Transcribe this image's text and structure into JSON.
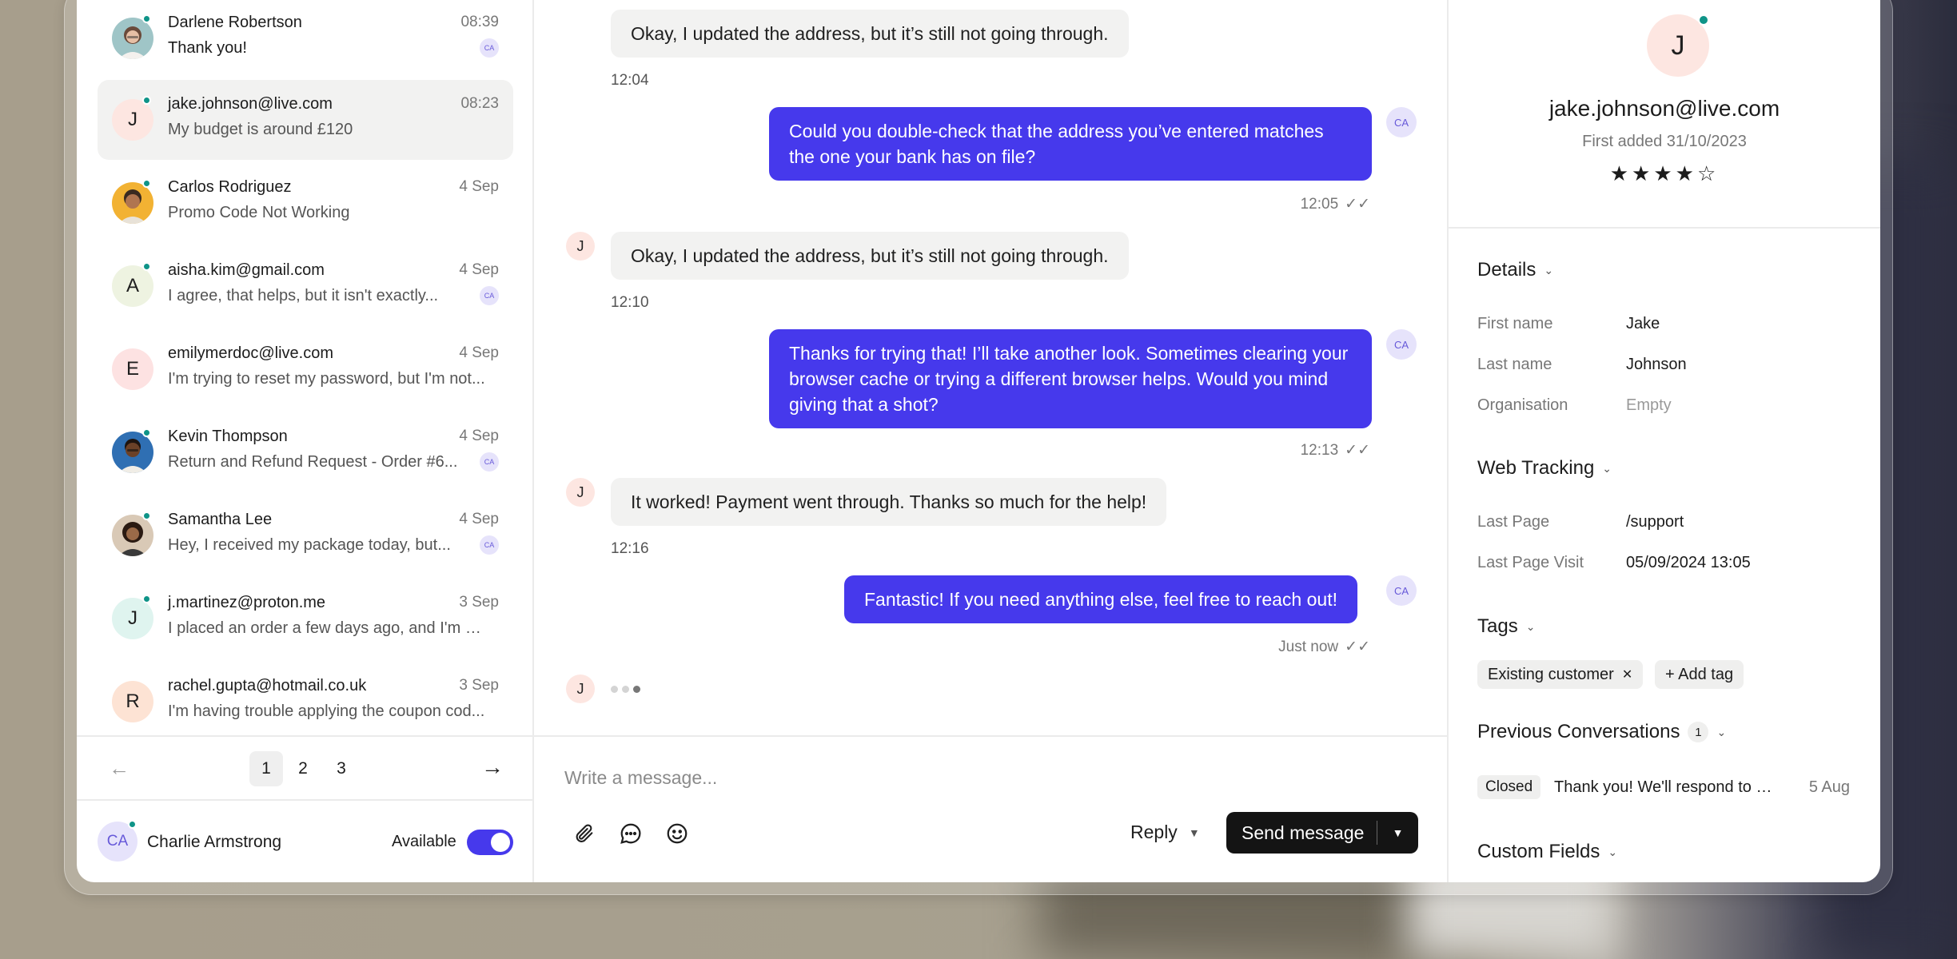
{
  "conversations": [
    {
      "name": "Darlene Robertson",
      "time": "08:39",
      "preview": "Thank you!",
      "initial": "",
      "agent_badge": "CA",
      "active": false
    },
    {
      "name": "jake.johnson@live.com",
      "time": "08:23",
      "preview": "My budget is around £120",
      "initial": "J",
      "agent_badge": "",
      "active": true
    },
    {
      "name": "Carlos Rodriguez",
      "time": "4 Sep",
      "preview": "Promo Code Not Working",
      "initial": "",
      "agent_badge": "",
      "active": false
    },
    {
      "name": "aisha.kim@gmail.com",
      "time": "4 Sep",
      "preview": "I agree, that helps, but it isn't exactly...",
      "initial": "A",
      "agent_badge": "CA",
      "active": false
    },
    {
      "name": "emilymerdoc@live.com",
      "time": "4 Sep",
      "preview": "I'm trying to reset my password, but I'm not...",
      "initial": "E",
      "agent_badge": "",
      "active": false
    },
    {
      "name": "Kevin Thompson",
      "time": "4 Sep",
      "preview": "Return and Refund Request - Order #6...",
      "initial": "",
      "agent_badge": "CA",
      "active": false
    },
    {
      "name": "Samantha Lee",
      "time": "4 Sep",
      "preview": "Hey, I received my package today, but...",
      "initial": "",
      "agent_badge": "CA",
      "active": false
    },
    {
      "name": "j.martinez@proton.me",
      "time": "3 Sep",
      "preview": "I placed an order a few days ago, and I'm w...",
      "initial": "J",
      "agent_badge": "",
      "active": false
    },
    {
      "name": "rachel.gupta@hotmail.co.uk",
      "time": "3 Sep",
      "preview": "I'm having trouble applying the coupon cod...",
      "initial": "R",
      "agent_badge": "",
      "active": false
    }
  ],
  "pagination": {
    "pages": [
      "1",
      "2",
      "3"
    ],
    "current": "1",
    "prev_icon": "arrow-left-icon",
    "next_icon": "arrow-right-icon"
  },
  "agent": {
    "initials": "CA",
    "name": "Charlie Armstrong",
    "status_label": "Available",
    "available": true
  },
  "messages": [
    {
      "dir": "in",
      "text": "Okay, I updated the address, but it’s still not going through.",
      "time": "12:04",
      "avatar": ""
    },
    {
      "dir": "out",
      "text": "Could you double-check that the address you’ve entered matches the one your bank has on file?",
      "time": "12:05",
      "avatar": "CA"
    },
    {
      "dir": "in",
      "text": "Okay, I updated the address, but it’s still not going through.",
      "time": "12:10",
      "avatar": "J"
    },
    {
      "dir": "out",
      "text": "Thanks for trying that! I’ll take another look. Sometimes clearing your browser cache or trying a different browser helps. Would you mind giving that a shot?",
      "time": "12:13",
      "avatar": "CA"
    },
    {
      "dir": "in",
      "text": "It worked! Payment went through. Thanks so much for the help!",
      "time": "12:16",
      "avatar": "J"
    },
    {
      "dir": "out",
      "text": "Fantastic! If you need anything else, feel free to reach out!",
      "time": "Just now",
      "avatar": "CA"
    }
  ],
  "typing_avatar": "J",
  "composer": {
    "placeholder": "Write a message...",
    "reply_label": "Reply",
    "send_label": "Send message",
    "icons": [
      "paperclip-icon",
      "chat-bubble-icon",
      "emoji-icon"
    ]
  },
  "contact": {
    "initial": "J",
    "email": "jake.johnson@live.com",
    "first_added": "First added 31/10/2023",
    "rating": 4,
    "rating_max": 5,
    "stars_text": "★★★★☆",
    "details_title": "Details",
    "fields": [
      {
        "label": "First name",
        "value": "Jake"
      },
      {
        "label": "Last name",
        "value": "Johnson"
      },
      {
        "label": "Organisation",
        "value": "Empty"
      }
    ],
    "web_tracking_title": "Web Tracking",
    "tracking": [
      {
        "label": "Last Page",
        "value": "/support"
      },
      {
        "label": "Last Page Visit",
        "value": "05/09/2024 13:05"
      }
    ],
    "tags_title": "Tags",
    "tags": [
      "Existing customer"
    ],
    "add_tag_label": "+ Add tag",
    "prev_title": "Previous Conversations",
    "prev_count": "1",
    "prev": [
      {
        "status": "Closed",
        "text": "Thank you! We'll respond to your query shortly.",
        "date": "5 Aug"
      }
    ],
    "custom_fields_title": "Custom Fields"
  },
  "colors": {
    "accent": "#4639ec",
    "online": "#0f9488",
    "bubble_in": "#f2f2f1"
  }
}
